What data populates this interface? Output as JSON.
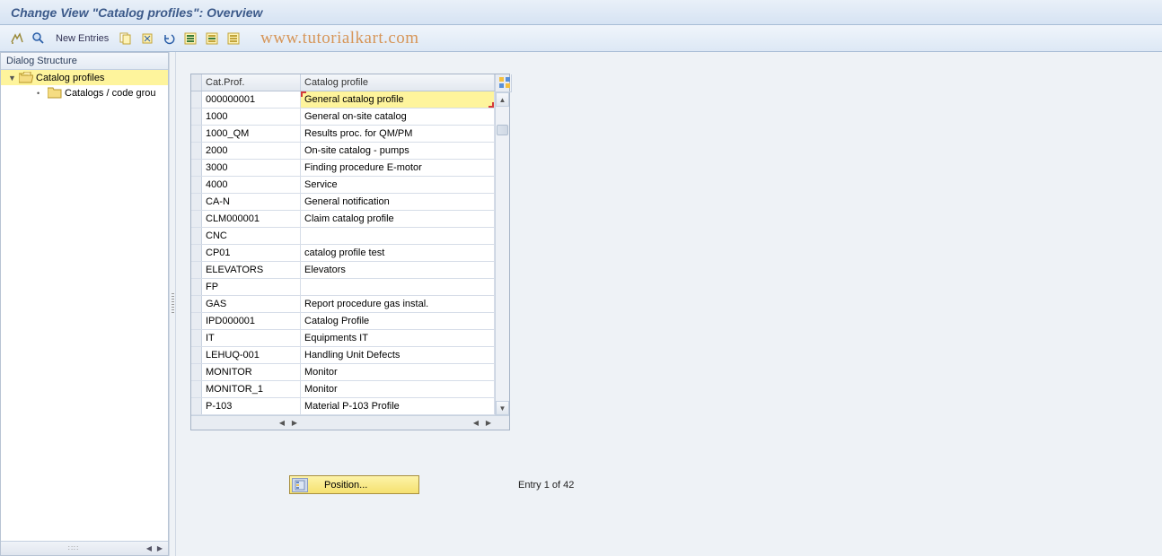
{
  "title": "Change View \"Catalog profiles\": Overview",
  "toolbar": {
    "new_entries": "New Entries"
  },
  "watermark": "www.tutorialkart.com",
  "sidebar": {
    "header": "Dialog Structure",
    "items": [
      {
        "label": "Catalog profiles",
        "level": 1,
        "selected": true,
        "open": true
      },
      {
        "label": "Catalogs / code grou",
        "level": 2,
        "selected": false,
        "open": false
      }
    ]
  },
  "table": {
    "headers": {
      "col1": "Cat.Prof.",
      "col2": "Catalog profile"
    },
    "rows": [
      {
        "c1": "000000001",
        "c2": "General catalog profile"
      },
      {
        "c1": "1000",
        "c2": "General on-site catalog"
      },
      {
        "c1": "1000_QM",
        "c2": "Results proc. for QM/PM"
      },
      {
        "c1": "2000",
        "c2": "On-site catalog - pumps"
      },
      {
        "c1": "3000",
        "c2": "Finding procedure E-motor"
      },
      {
        "c1": "4000",
        "c2": "Service"
      },
      {
        "c1": "CA-N",
        "c2": "General notification"
      },
      {
        "c1": "CLM000001",
        "c2": "Claim catalog profile"
      },
      {
        "c1": "CNC",
        "c2": ""
      },
      {
        "c1": "CP01",
        "c2": "catalog profile test"
      },
      {
        "c1": "ELEVATORS",
        "c2": "Elevators"
      },
      {
        "c1": "FP",
        "c2": ""
      },
      {
        "c1": "GAS",
        "c2": "Report procedure gas instal."
      },
      {
        "c1": "IPD000001",
        "c2": "Catalog Profile"
      },
      {
        "c1": "IT",
        "c2": "Equipments IT"
      },
      {
        "c1": "LEHUQ-001",
        "c2": "Handling Unit Defects"
      },
      {
        "c1": "MONITOR",
        "c2": "Monitor"
      },
      {
        "c1": "MONITOR_1",
        "c2": "Monitor"
      },
      {
        "c1": "P-103",
        "c2": "Material P-103 Profile"
      }
    ]
  },
  "footer": {
    "position_label": "Position...",
    "entry_label": "Entry 1 of 42"
  }
}
